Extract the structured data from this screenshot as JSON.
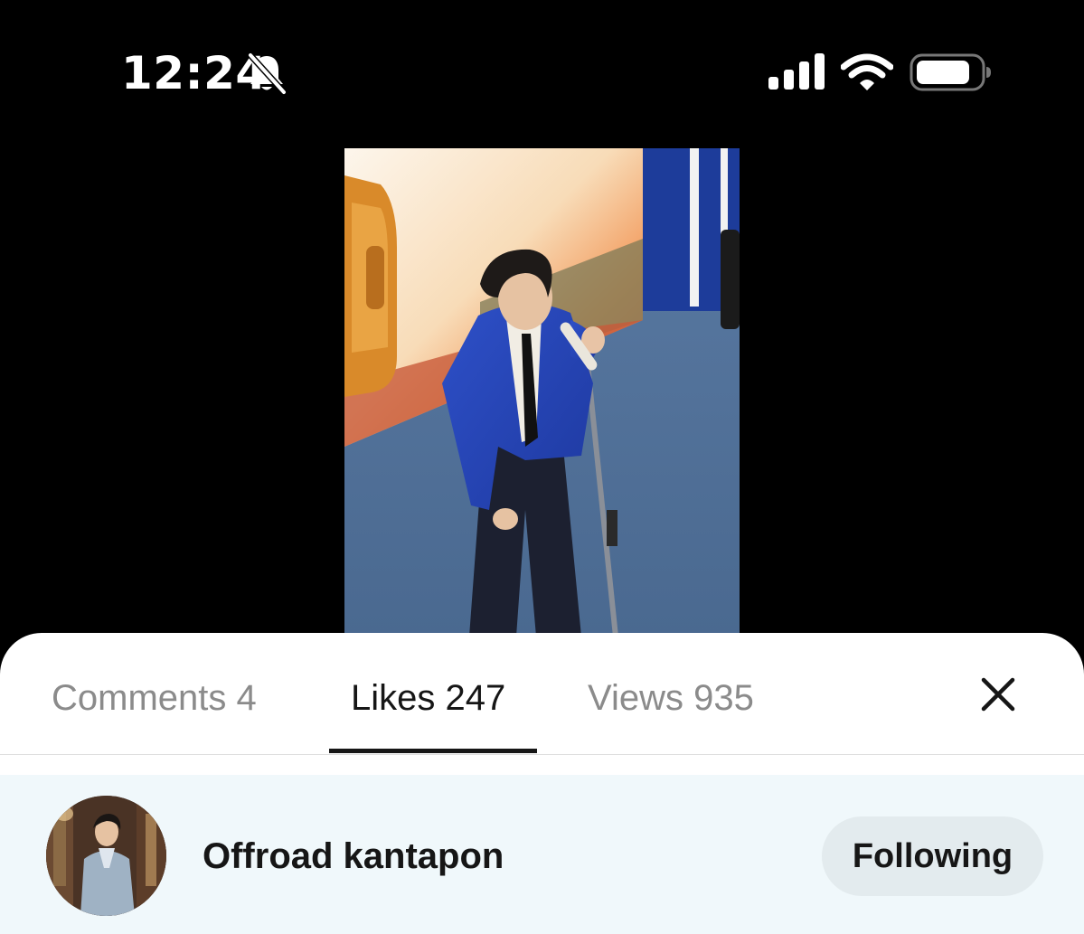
{
  "status_bar": {
    "time": "12:24",
    "icons": [
      "bell-slash-icon",
      "cellular-signal-icon",
      "wifi-icon",
      "battery-icon"
    ]
  },
  "video": {
    "description_icon": "performer-video-thumbnail"
  },
  "sheet": {
    "tabs": [
      {
        "label": "Comments 4",
        "active": false
      },
      {
        "label": "Likes 247",
        "active": true
      },
      {
        "label": "Views 935",
        "active": false
      }
    ],
    "close_icon": "close-icon",
    "users": [
      {
        "name": "Offroad kantapon",
        "follow_label": "Following"
      }
    ]
  },
  "colors": {
    "background": "#000000",
    "sheet": "#ffffff",
    "row_highlight": "#f0f8fb",
    "button_bg": "#e3ebee",
    "text_primary": "#161616",
    "text_secondary": "#8b8b8b"
  }
}
